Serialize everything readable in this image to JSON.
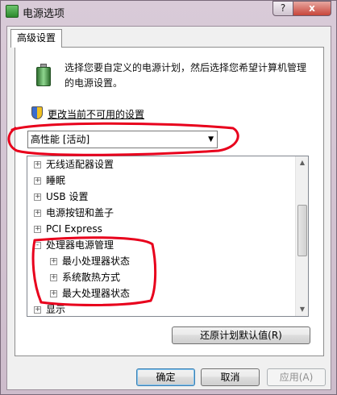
{
  "window": {
    "title": "电源选项",
    "help_label": "?",
    "close_label": "x"
  },
  "tab": {
    "label": "高级设置"
  },
  "intro": {
    "line1": "选择您要自定义的电源计划，然后选择您希望计算机管理",
    "line2": "的电源设置。"
  },
  "change_link": "更改当前不可用的设置",
  "plan_select": {
    "value": "高性能 [活动]"
  },
  "tree": {
    "items": [
      {
        "label": "无线适配器设置",
        "expander": "+"
      },
      {
        "label": "睡眠",
        "expander": "+"
      },
      {
        "label": "USB 设置",
        "expander": "+"
      },
      {
        "label": "电源按钮和盖子",
        "expander": "+"
      },
      {
        "label": "PCI Express",
        "expander": "+"
      },
      {
        "label": "处理器电源管理",
        "expander": "-"
      },
      {
        "label": "最小处理器状态",
        "expander": "+"
      },
      {
        "label": "系统散热方式",
        "expander": "+"
      },
      {
        "label": "最大处理器状态",
        "expander": "+"
      },
      {
        "label": "显示",
        "expander": "+"
      }
    ]
  },
  "buttons": {
    "restore": "还原计划默认值(R)",
    "ok": "确定",
    "cancel": "取消",
    "apply": "应用(A)"
  },
  "colors": {
    "annotation_red": "#e8001c",
    "window_frame": "#d4c6d3"
  },
  "icons": {
    "title": "power-options-icon",
    "battery": "battery-icon",
    "shield": "uac-shield-icon"
  }
}
